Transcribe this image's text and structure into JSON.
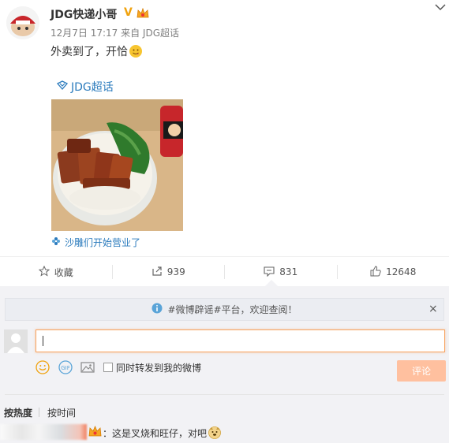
{
  "post": {
    "username": "JDG快递小哥",
    "meta": "12月7日 17:17 来自 JDG超话",
    "text": "外卖到了，开恰",
    "topic": "JDG超话",
    "caption": "沙雕们开始营业了",
    "verified_icon": "verified-v-icon",
    "emoji": "grin-emoji"
  },
  "actions": [
    {
      "label": "收藏",
      "icon": "star-icon"
    },
    {
      "label": "939",
      "icon": "share-icon"
    },
    {
      "label": "831",
      "icon": "comment-icon"
    },
    {
      "label": "12648",
      "icon": "like-icon"
    }
  ],
  "comment_box": {
    "notice": "#微博辟谣#平台，欢迎查阅！",
    "forward_label": "同时转发到我的微博",
    "submit_label": "评论"
  },
  "sort": {
    "hot": "按热度",
    "time": "按时间"
  },
  "comments": [
    {
      "text": "：这是叉烧和旺仔，对吧"
    }
  ],
  "colors": {
    "link": "#2b7bbd",
    "accent": "#ff8140",
    "submit_disabled": "#ffc09f",
    "verified": "#f0a20d"
  }
}
